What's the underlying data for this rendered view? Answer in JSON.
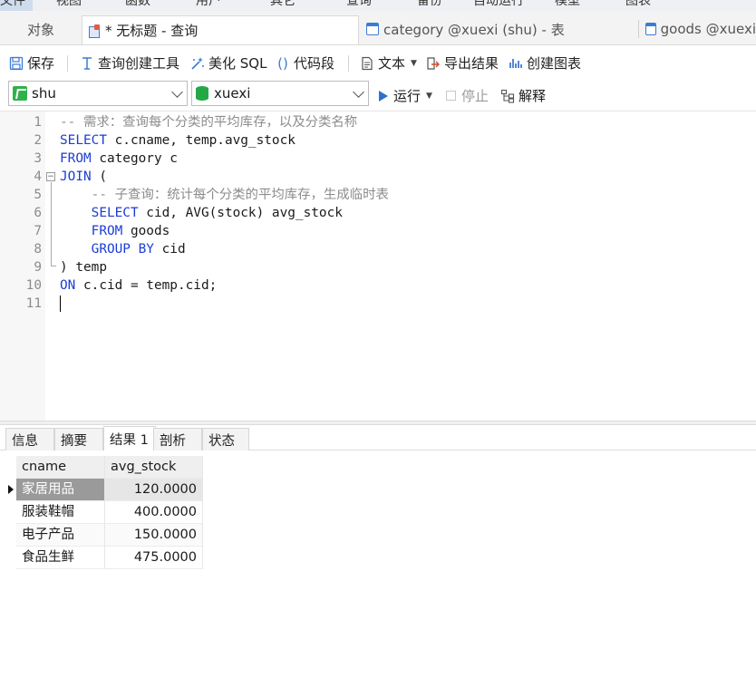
{
  "menubar": {
    "items": [
      "文件",
      "视图",
      "函数",
      "用户",
      "其它",
      "查询",
      "备份",
      "自动运行",
      "模型",
      "图表"
    ]
  },
  "tabs": {
    "objects": "对象",
    "query": "* 无标题 - 查询",
    "category": "category @xuexi (shu) - 表",
    "goods": "goods @xuexi"
  },
  "toolbar": {
    "save": "保存",
    "query_builder": "查询创建工具",
    "beautify": "美化 SQL",
    "snippet": "代码段",
    "text": "文本",
    "export": "导出结果",
    "chart": "创建图表",
    "icons": [
      "save-icon",
      "query-builder-icon",
      "beautify-icon",
      "snippet-icon",
      "text-icon",
      "export-icon",
      "chart-icon"
    ]
  },
  "connection": {
    "connection": "shu",
    "database": "xuexi",
    "run": "运行",
    "stop": "停止",
    "explain": "解释"
  },
  "editor": {
    "lines": [
      {
        "n": "1",
        "parts": [
          [
            "cm",
            "-- 需求：查询每个分类的平均库存，以及分类名称"
          ]
        ]
      },
      {
        "n": "2",
        "parts": [
          [
            "kw",
            "SELECT"
          ],
          [
            "tx",
            " c.cname, temp.avg_stock"
          ]
        ]
      },
      {
        "n": "3",
        "parts": [
          [
            "kw",
            "FROM"
          ],
          [
            "tx",
            " category c"
          ]
        ]
      },
      {
        "n": "4",
        "parts": [
          [
            "kw",
            "JOIN"
          ],
          [
            "tx",
            " ("
          ]
        ]
      },
      {
        "n": "5",
        "parts": [
          [
            "cm",
            "    -- 子查询：统计每个分类的平均库存，生成临时表"
          ]
        ]
      },
      {
        "n": "6",
        "parts": [
          [
            "kw",
            "    SELECT"
          ],
          [
            "tx",
            " cid, AVG(stock) avg_stock"
          ]
        ]
      },
      {
        "n": "7",
        "parts": [
          [
            "kw",
            "    FROM"
          ],
          [
            "tx",
            " goods"
          ]
        ]
      },
      {
        "n": "8",
        "parts": [
          [
            "kw",
            "    GROUP BY"
          ],
          [
            "tx",
            " cid"
          ]
        ]
      },
      {
        "n": "9",
        "parts": [
          [
            "tx",
            ") temp"
          ]
        ]
      },
      {
        "n": "10",
        "parts": [
          [
            "kw",
            "ON"
          ],
          [
            "tx",
            " c.cid = temp.cid;"
          ]
        ]
      },
      {
        "n": "11",
        "parts": []
      }
    ]
  },
  "results": {
    "tabs": [
      "信息",
      "摘要",
      "结果 1",
      "剖析",
      "状态"
    ],
    "active_tab": "结果 1",
    "columns": [
      "cname",
      "avg_stock"
    ],
    "rows": [
      [
        "家居用品",
        "120.0000"
      ],
      [
        "服装鞋帽",
        "400.0000"
      ],
      [
        "电子产品",
        "150.0000"
      ],
      [
        "食品生鲜",
        "475.0000"
      ]
    ]
  },
  "colors": {
    "keyword": "#1a3dd6",
    "comment": "#8c8c8c",
    "selected_row": "#9a9a9a"
  }
}
